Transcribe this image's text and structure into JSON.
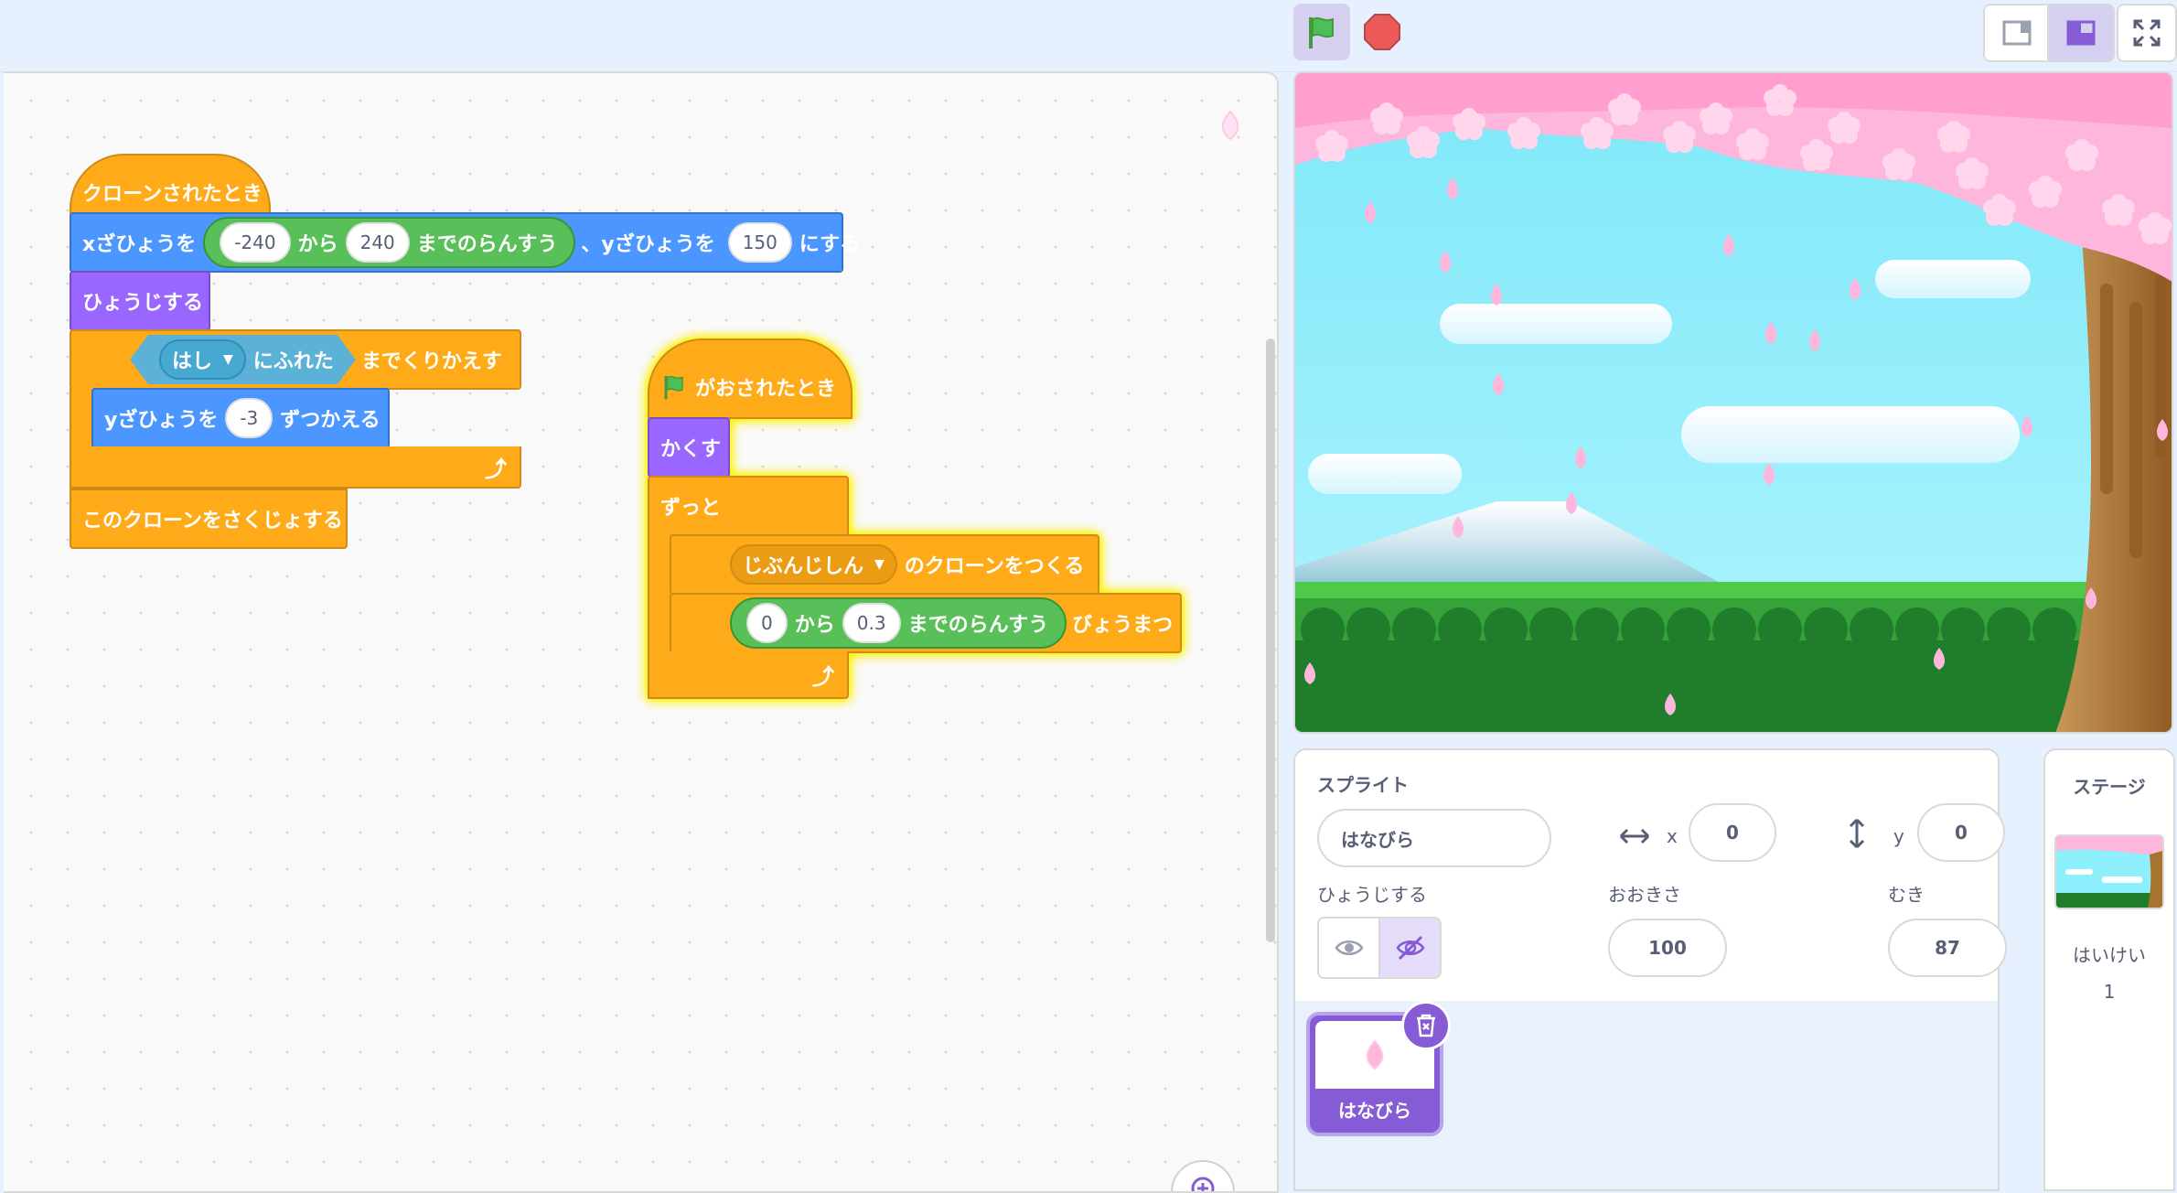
{
  "code": {
    "script1": {
      "hat": "クローンされたとき",
      "motion_pre": "xざひょうを",
      "rand_min": "-240",
      "rand_from": "から",
      "rand_max": "240",
      "rand_to": "までのらんすう",
      "motion_mid": "、yざひょうを",
      "y_value": "150",
      "motion_post": "にする",
      "show": "ひょうじする",
      "touch_target": "はし",
      "touch_label": "にふれた",
      "repeat_until": "までくりかえす",
      "change_y_pre": "yざひょうを",
      "change_y_value": "-3",
      "change_y_post": "ずつかえる",
      "delete_clone": "このクローンをさくじょする"
    },
    "script2": {
      "hat": "がおされたとき",
      "hide": "かくす",
      "forever": "ずっと",
      "clone_target": "じぶんじしん",
      "clone_label": "のクローンをつくる",
      "wait_min": "0",
      "wait_from": "から",
      "wait_max": "0.3",
      "wait_to": "までのらんすう",
      "wait_post": "びょうまつ"
    }
  },
  "sprite_info": {
    "sprite_label": "スプライト",
    "sprite_name": "はなびら",
    "x_label": "x",
    "x_value": "0",
    "y_label": "y",
    "y_value": "0",
    "show_label": "ひょうじする",
    "size_label": "おおきさ",
    "size_value": "100",
    "direction_label": "むき",
    "direction_value": "87"
  },
  "sprite_list": [
    {
      "name": "はなびら",
      "selected": true
    }
  ],
  "stage_pane": {
    "title": "ステージ",
    "backdrop_label": "はいけい",
    "backdrop_count": "1"
  },
  "colors": {
    "events": "#ffab19",
    "motion": "#4c97ff",
    "looks": "#9966ff",
    "operators": "#59c059",
    "sensing": "#5cb1d6",
    "accent": "#855cd6"
  }
}
